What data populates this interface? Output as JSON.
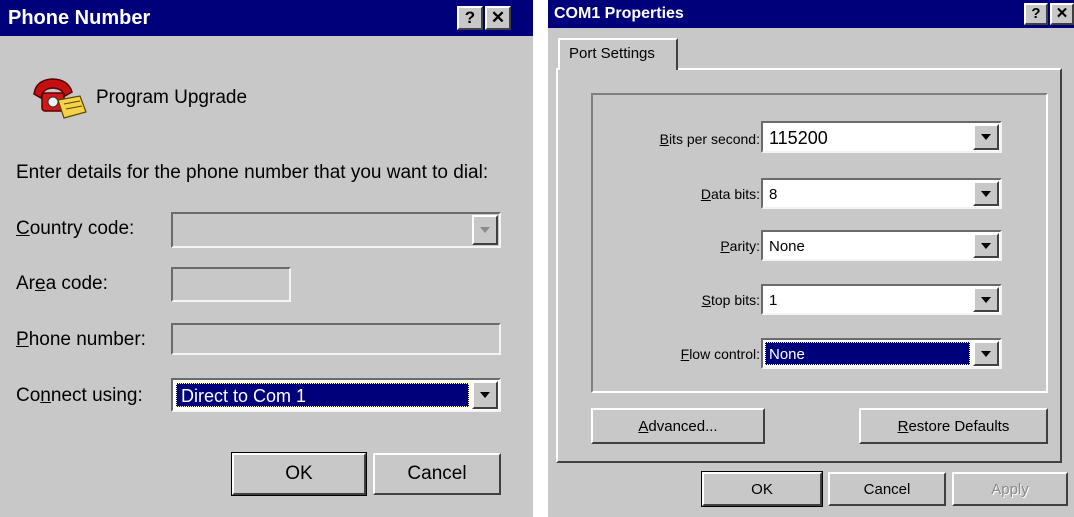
{
  "left_dialog": {
    "title": "Phone Number",
    "help_glyph": "?",
    "close_glyph": "✕",
    "app_icon": "phone-icon",
    "app_name": "Program Upgrade",
    "instructions": "Enter details for the phone number that you want to dial:",
    "country_code": {
      "mnemonic": "C",
      "label_rest": "ountry code:",
      "value": ""
    },
    "area_code": {
      "label_pre": "Ar",
      "mnemonic": "e",
      "label_post": "a code:",
      "value": ""
    },
    "phone_number": {
      "mnemonic": "P",
      "label_rest": "hone number:",
      "value": ""
    },
    "connect_using": {
      "label_pre": "Co",
      "mnemonic": "n",
      "label_post": "nect using:",
      "value": "Direct to Com 1"
    },
    "ok_label": "OK",
    "cancel_label": "Cancel"
  },
  "right_dialog": {
    "title": "COM1 Properties",
    "help_glyph": "?",
    "close_glyph": "✕",
    "tab_label": "Port Settings",
    "bits_per_second": {
      "mnemonic": "B",
      "label_rest": "its per second:",
      "value": "115200"
    },
    "data_bits": {
      "mnemonic": "D",
      "label_rest": "ata bits:",
      "value": "8"
    },
    "parity": {
      "mnemonic": "P",
      "label_rest": "arity:",
      "value": "None"
    },
    "stop_bits": {
      "mnemonic": "S",
      "label_rest": "top bits:",
      "value": "1"
    },
    "flow_control": {
      "mnemonic": "F",
      "label_rest": "low control:",
      "value": "None"
    },
    "advanced": {
      "mnemonic": "A",
      "label_rest": "dvanced..."
    },
    "restore": {
      "mnemonic": "R",
      "label_rest": "estore Defaults"
    },
    "ok_label": "OK",
    "cancel_label": "Cancel",
    "apply_label": "Apply"
  }
}
